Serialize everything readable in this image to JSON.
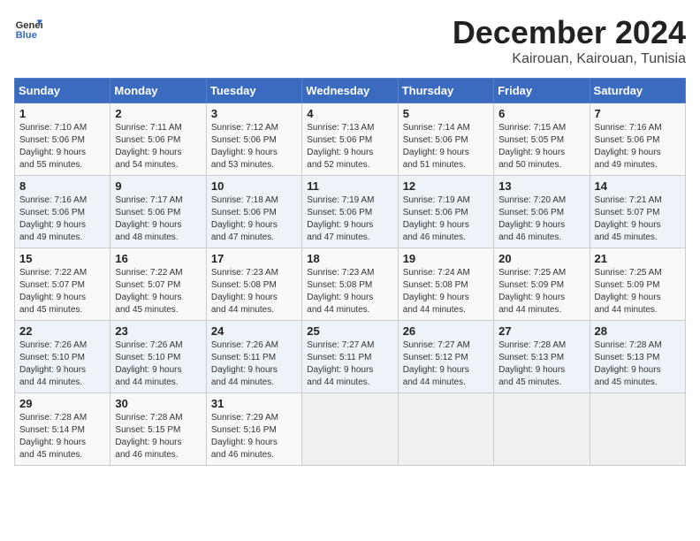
{
  "header": {
    "logo_line1": "General",
    "logo_line2": "Blue",
    "title": "December 2024",
    "subtitle": "Kairouan, Kairouan, Tunisia"
  },
  "calendar": {
    "days_of_week": [
      "Sunday",
      "Monday",
      "Tuesday",
      "Wednesday",
      "Thursday",
      "Friday",
      "Saturday"
    ],
    "weeks": [
      [
        {
          "day": "1",
          "info": "Sunrise: 7:10 AM\nSunset: 5:06 PM\nDaylight: 9 hours\nand 55 minutes."
        },
        {
          "day": "2",
          "info": "Sunrise: 7:11 AM\nSunset: 5:06 PM\nDaylight: 9 hours\nand 54 minutes."
        },
        {
          "day": "3",
          "info": "Sunrise: 7:12 AM\nSunset: 5:06 PM\nDaylight: 9 hours\nand 53 minutes."
        },
        {
          "day": "4",
          "info": "Sunrise: 7:13 AM\nSunset: 5:06 PM\nDaylight: 9 hours\nand 52 minutes."
        },
        {
          "day": "5",
          "info": "Sunrise: 7:14 AM\nSunset: 5:06 PM\nDaylight: 9 hours\nand 51 minutes."
        },
        {
          "day": "6",
          "info": "Sunrise: 7:15 AM\nSunset: 5:05 PM\nDaylight: 9 hours\nand 50 minutes."
        },
        {
          "day": "7",
          "info": "Sunrise: 7:16 AM\nSunset: 5:06 PM\nDaylight: 9 hours\nand 49 minutes."
        }
      ],
      [
        {
          "day": "8",
          "info": "Sunrise: 7:16 AM\nSunset: 5:06 PM\nDaylight: 9 hours\nand 49 minutes."
        },
        {
          "day": "9",
          "info": "Sunrise: 7:17 AM\nSunset: 5:06 PM\nDaylight: 9 hours\nand 48 minutes."
        },
        {
          "day": "10",
          "info": "Sunrise: 7:18 AM\nSunset: 5:06 PM\nDaylight: 9 hours\nand 47 minutes."
        },
        {
          "day": "11",
          "info": "Sunrise: 7:19 AM\nSunset: 5:06 PM\nDaylight: 9 hours\nand 47 minutes."
        },
        {
          "day": "12",
          "info": "Sunrise: 7:19 AM\nSunset: 5:06 PM\nDaylight: 9 hours\nand 46 minutes."
        },
        {
          "day": "13",
          "info": "Sunrise: 7:20 AM\nSunset: 5:06 PM\nDaylight: 9 hours\nand 46 minutes."
        },
        {
          "day": "14",
          "info": "Sunrise: 7:21 AM\nSunset: 5:07 PM\nDaylight: 9 hours\nand 45 minutes."
        }
      ],
      [
        {
          "day": "15",
          "info": "Sunrise: 7:22 AM\nSunset: 5:07 PM\nDaylight: 9 hours\nand 45 minutes."
        },
        {
          "day": "16",
          "info": "Sunrise: 7:22 AM\nSunset: 5:07 PM\nDaylight: 9 hours\nand 45 minutes."
        },
        {
          "day": "17",
          "info": "Sunrise: 7:23 AM\nSunset: 5:08 PM\nDaylight: 9 hours\nand 44 minutes."
        },
        {
          "day": "18",
          "info": "Sunrise: 7:23 AM\nSunset: 5:08 PM\nDaylight: 9 hours\nand 44 minutes."
        },
        {
          "day": "19",
          "info": "Sunrise: 7:24 AM\nSunset: 5:08 PM\nDaylight: 9 hours\nand 44 minutes."
        },
        {
          "day": "20",
          "info": "Sunrise: 7:25 AM\nSunset: 5:09 PM\nDaylight: 9 hours\nand 44 minutes."
        },
        {
          "day": "21",
          "info": "Sunrise: 7:25 AM\nSunset: 5:09 PM\nDaylight: 9 hours\nand 44 minutes."
        }
      ],
      [
        {
          "day": "22",
          "info": "Sunrise: 7:26 AM\nSunset: 5:10 PM\nDaylight: 9 hours\nand 44 minutes."
        },
        {
          "day": "23",
          "info": "Sunrise: 7:26 AM\nSunset: 5:10 PM\nDaylight: 9 hours\nand 44 minutes."
        },
        {
          "day": "24",
          "info": "Sunrise: 7:26 AM\nSunset: 5:11 PM\nDaylight: 9 hours\nand 44 minutes."
        },
        {
          "day": "25",
          "info": "Sunrise: 7:27 AM\nSunset: 5:11 PM\nDaylight: 9 hours\nand 44 minutes."
        },
        {
          "day": "26",
          "info": "Sunrise: 7:27 AM\nSunset: 5:12 PM\nDaylight: 9 hours\nand 44 minutes."
        },
        {
          "day": "27",
          "info": "Sunrise: 7:28 AM\nSunset: 5:13 PM\nDaylight: 9 hours\nand 45 minutes."
        },
        {
          "day": "28",
          "info": "Sunrise: 7:28 AM\nSunset: 5:13 PM\nDaylight: 9 hours\nand 45 minutes."
        }
      ],
      [
        {
          "day": "29",
          "info": "Sunrise: 7:28 AM\nSunset: 5:14 PM\nDaylight: 9 hours\nand 45 minutes."
        },
        {
          "day": "30",
          "info": "Sunrise: 7:28 AM\nSunset: 5:15 PM\nDaylight: 9 hours\nand 46 minutes."
        },
        {
          "day": "31",
          "info": "Sunrise: 7:29 AM\nSunset: 5:16 PM\nDaylight: 9 hours\nand 46 minutes."
        },
        {
          "day": "",
          "info": ""
        },
        {
          "day": "",
          "info": ""
        },
        {
          "day": "",
          "info": ""
        },
        {
          "day": "",
          "info": ""
        }
      ]
    ]
  }
}
